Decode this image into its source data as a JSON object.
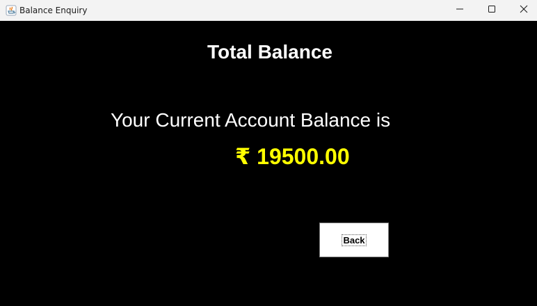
{
  "window": {
    "title": "Balance Enquiry",
    "icon": "java-icon",
    "controls": {
      "minimize_icon": "minimize-icon",
      "maximize_icon": "maximize-icon",
      "close_icon": "close-icon"
    }
  },
  "main": {
    "heading": "Total Balance",
    "balance_label": "Your Current Account Balance is",
    "balance_amount": "₹ 19500.00",
    "back_button_label": "Back"
  },
  "colors": {
    "background": "#000000",
    "heading": "#ffffff",
    "amount": "#ffff00",
    "button_bg": "#ffffff"
  }
}
